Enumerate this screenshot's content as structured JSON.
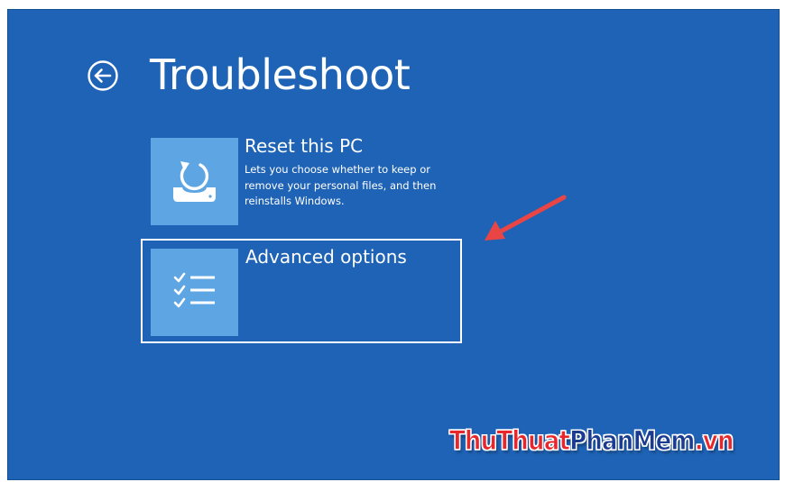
{
  "screen": {
    "title": "Troubleshoot",
    "background_color": "#1f63b6"
  },
  "back_button": {
    "icon": "back-arrow-icon"
  },
  "options": [
    {
      "title": "Reset this PC",
      "description": "Lets you choose whether to keep or remove your personal files, and then reinstalls Windows.",
      "icon": "reset-pc-icon",
      "selected": false
    },
    {
      "title": "Advanced options",
      "description": "",
      "icon": "checklist-icon",
      "selected": true
    }
  ],
  "annotation": {
    "icon": "red-arrow-pointer",
    "color": "#e94545"
  },
  "watermark": {
    "part1": "ThuThuat",
    "part2": "PhanMem",
    "part3": ".vn"
  }
}
